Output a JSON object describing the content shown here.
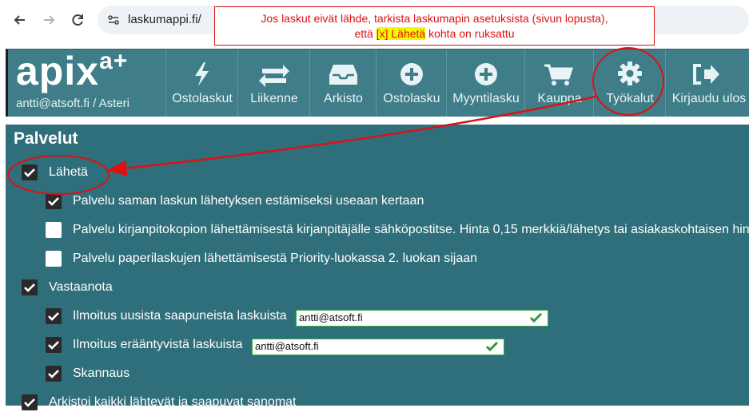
{
  "browser": {
    "url": "laskumappi.fi/",
    "back_icon": "arrow-left-icon",
    "forward_icon": "arrow-right-icon",
    "reload_icon": "reload-icon"
  },
  "callout": {
    "line1": "Jos laskut eivät lähde, tarkista laskumapin asetuksista (sivun lopusta),",
    "line2_prefix": "että",
    "line2_highlight": "[x] Lähetä",
    "line2_suffix": "kohta on ruksattu"
  },
  "header": {
    "logo_text": "apix",
    "logo_sup": "a+",
    "user": "antti@atsoft.fi / Asteri",
    "nav": [
      {
        "label": "Ostolaskut",
        "icon": "bolt-icon"
      },
      {
        "label": "Liikenne",
        "icon": "exchange-icon"
      },
      {
        "label": "Arkisto",
        "icon": "inbox-icon"
      },
      {
        "label": "Ostolasku",
        "icon": "plus-circle-icon"
      },
      {
        "label": "Myyntilasku",
        "icon": "plus-circle-icon"
      },
      {
        "label": "Kauppa",
        "icon": "cart-icon"
      },
      {
        "label": "Työkalut",
        "icon": "gear-icon"
      },
      {
        "label": "Kirjaudu ulos",
        "icon": "sign-out-icon"
      }
    ]
  },
  "panel": {
    "title": "Palvelut",
    "items": [
      {
        "label": "Lähetä",
        "checked": true
      },
      {
        "label": "Palvelu saman laskun lähetyksen estämiseksi useaan kertaan",
        "checked": true
      },
      {
        "label": "Palvelu kirjanpitokopion lähettämisestä kirjanpitäjälle sähköpostitse. Hinta 0,15 merkkiä/lähetys tai asiakaskohtaisen hin",
        "checked": false
      },
      {
        "label": "Palvelu paperilaskujen lähettämisestä Priority-luokassa 2. luokan sijaan",
        "checked": false
      },
      {
        "label": "Vastaanota",
        "checked": true
      },
      {
        "label": "Ilmoitus uusista saapuneista laskuista",
        "checked": true,
        "email": "antti@atsoft.fi"
      },
      {
        "label": "Ilmoitus erääntyvistä laskuista",
        "checked": true,
        "email": "antti@atsoft.fi"
      },
      {
        "label": "Skannaus",
        "checked": true
      },
      {
        "label": "Arkistoi kaikki lähtevät ja saapuvat sanomat",
        "checked": true
      }
    ]
  },
  "colors": {
    "header_bg": "#3f7d89",
    "panel_bg": "#2f6f7b",
    "annotation_red": "#dd1111",
    "highlight_yellow": "#f7f700"
  }
}
